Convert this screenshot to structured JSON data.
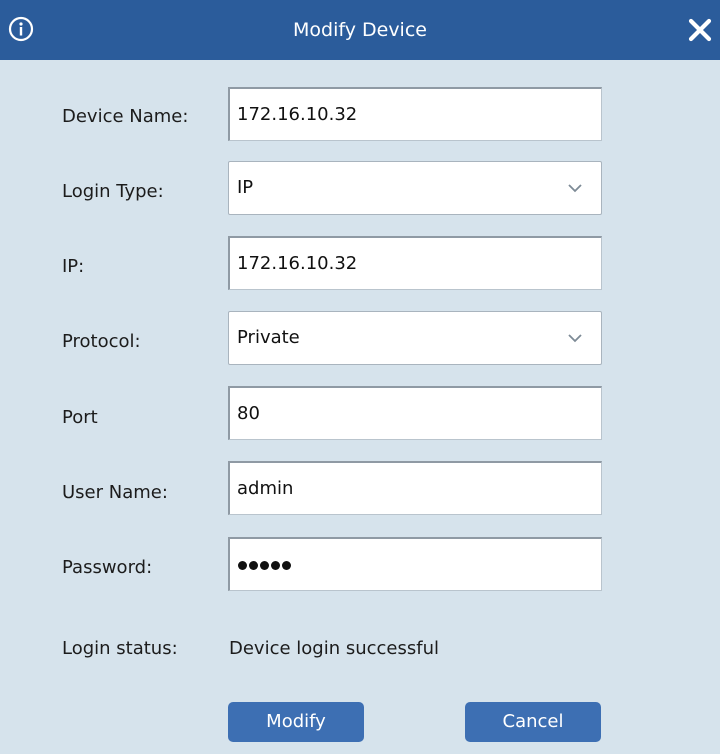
{
  "window": {
    "title": "Modify Device",
    "info_icon": "info-circle-icon",
    "close_icon": "close-x-icon"
  },
  "form": {
    "device_name": {
      "label": "Device Name:",
      "value": "172.16.10.32"
    },
    "login_type": {
      "label": "Login Type:",
      "value": "IP"
    },
    "ip": {
      "label": "IP:",
      "value": "172.16.10.32"
    },
    "protocol": {
      "label": "Protocol:",
      "value": "Private"
    },
    "port": {
      "label": "Port",
      "value": "80"
    },
    "user_name": {
      "label": "User Name:",
      "value": "admin"
    },
    "password": {
      "label": "Password:",
      "masked_length": 5
    }
  },
  "status": {
    "label": "Login status:",
    "text": "Device login successful"
  },
  "buttons": {
    "modify": "Modify",
    "cancel": "Cancel"
  },
  "colors": {
    "titlebar": "#2b5c9b",
    "background": "#d6e3ec",
    "button": "#3d6fb3"
  }
}
